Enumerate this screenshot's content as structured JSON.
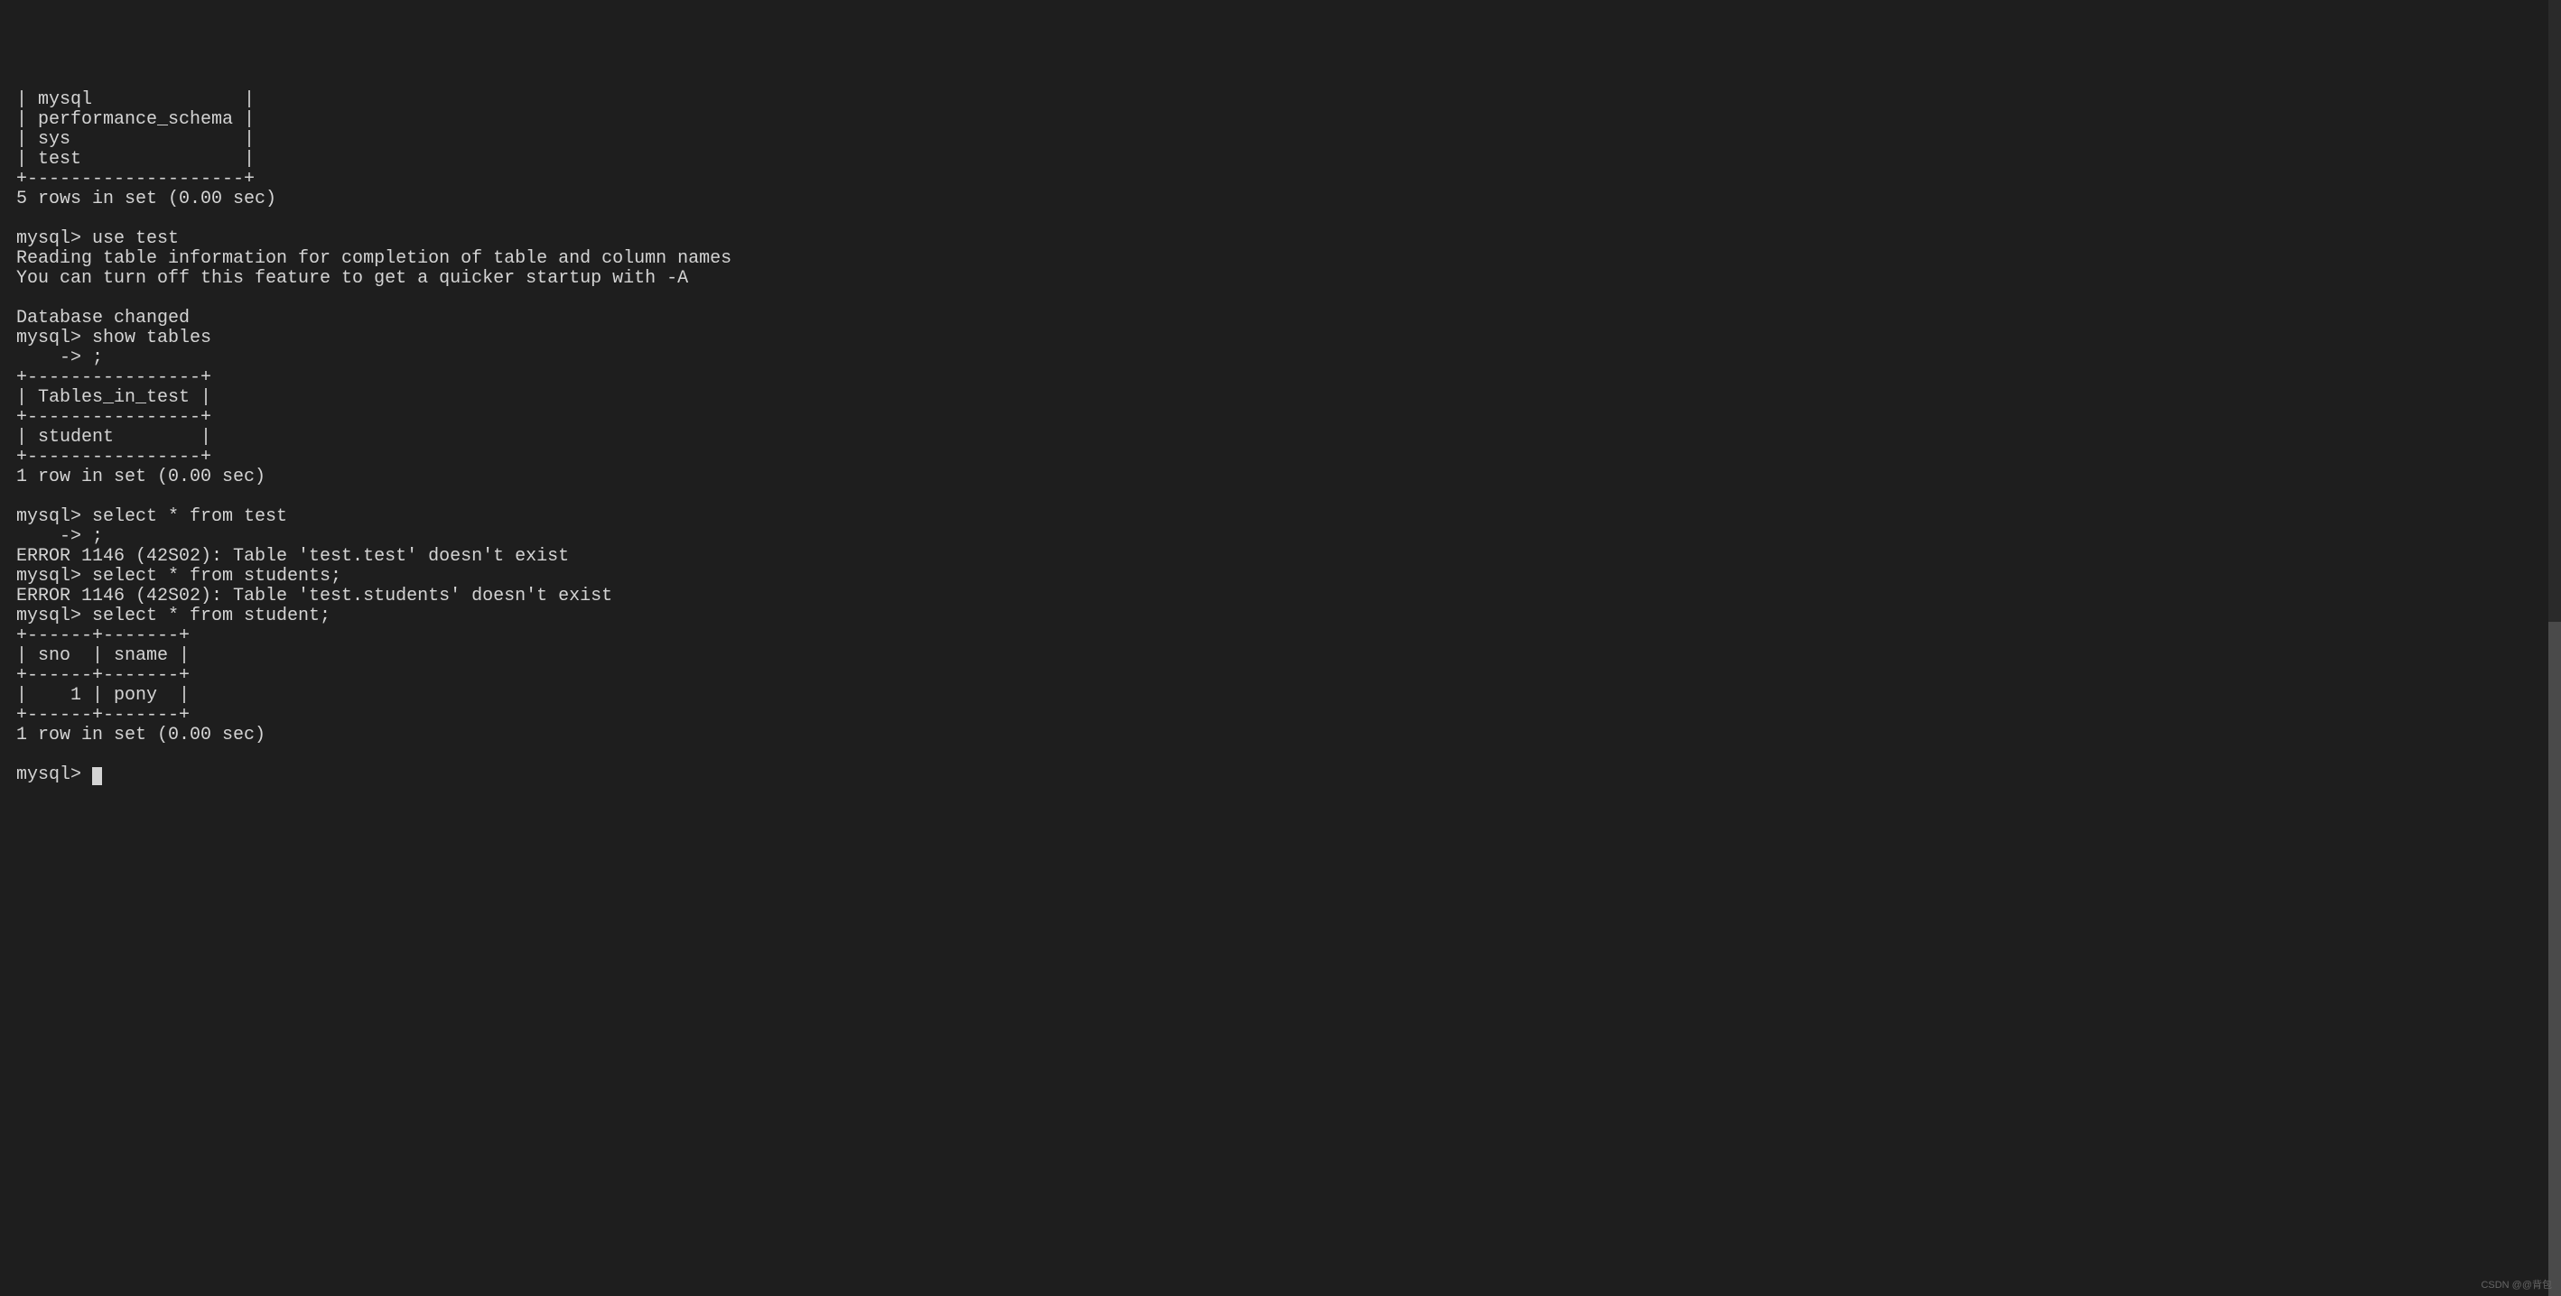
{
  "terminal": {
    "lines": [
      "| mysql              |",
      "| performance_schema |",
      "| sys                |",
      "| test               |",
      "+--------------------+",
      "5 rows in set (0.00 sec)",
      "",
      "mysql> use test",
      "Reading table information for completion of table and column names",
      "You can turn off this feature to get a quicker startup with -A",
      "",
      "Database changed",
      "mysql> show tables",
      "    -> ;",
      "+----------------+",
      "| Tables_in_test |",
      "+----------------+",
      "| student        |",
      "+----------------+",
      "1 row in set (0.00 sec)",
      "",
      "mysql> select * from test",
      "    -> ;",
      "ERROR 1146 (42S02): Table 'test.test' doesn't exist",
      "mysql> select * from students;",
      "ERROR 1146 (42S02): Table 'test.students' doesn't exist",
      "mysql> select * from student;",
      "+------+-------+",
      "| sno  | sname |",
      "+------+-------+",
      "|    1 | pony  |",
      "+------+-------+",
      "1 row in set (0.00 sec)",
      "",
      "mysql> "
    ],
    "prompt": "mysql> ",
    "watermark": "CSDN @@背包"
  }
}
